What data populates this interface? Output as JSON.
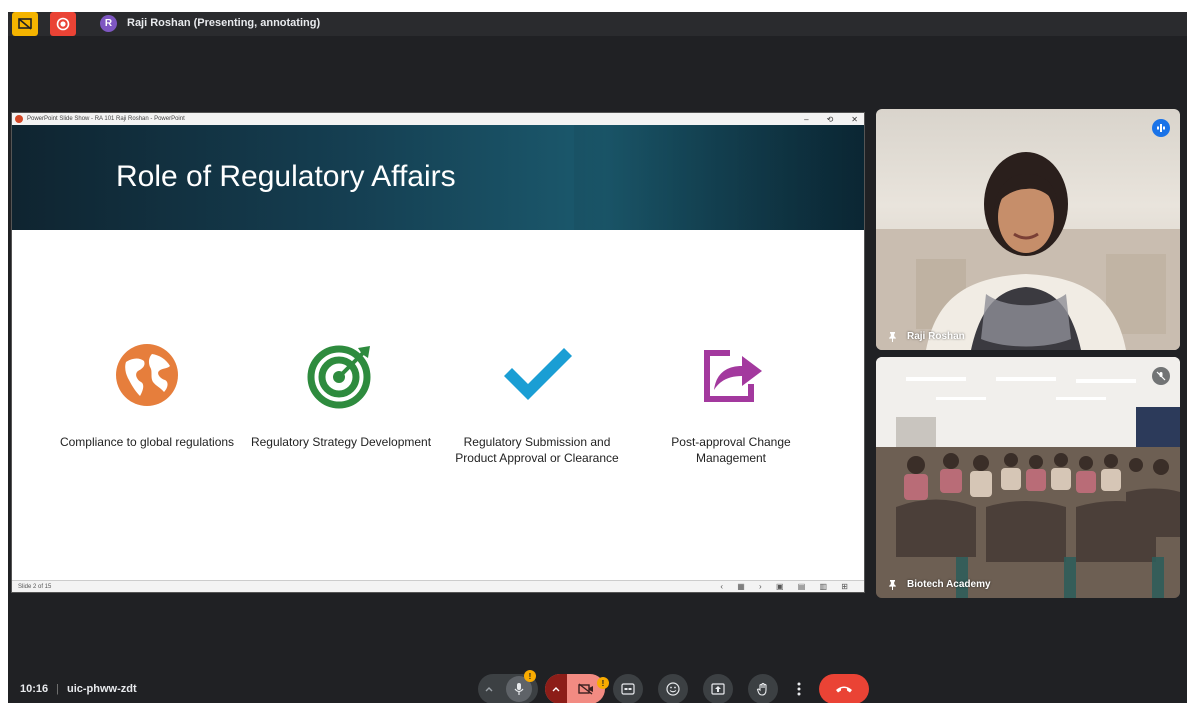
{
  "topbar": {
    "avatar_initial": "R",
    "presenter_text": "Raji Roshan (Presenting, annotating)"
  },
  "powerpoint": {
    "window_title": "PowerPoint Slide Show  -  RA 101 Raji Roshan - PowerPoint",
    "controls": [
      "–",
      "⟲",
      "✕"
    ],
    "status_left": "Slide 2 of 15",
    "status_right": "‹ ▦ › ▣ ▤ ▥ ⊞"
  },
  "slide": {
    "title": "Role of Regulatory Affairs",
    "features": [
      {
        "icon": "globe-icon",
        "color": "#e67e3c",
        "label": "Compliance to global regulations"
      },
      {
        "icon": "target-icon",
        "color": "#2e8b3e",
        "label": "Regulatory Strategy Development"
      },
      {
        "icon": "checkmark-icon",
        "color": "#1a9ed4",
        "label": "Regulatory Submission and Product Approval or Clearance"
      },
      {
        "icon": "share-arrow-icon",
        "color": "#a3399e",
        "label": "Post-approval Change Management"
      }
    ]
  },
  "participants": [
    {
      "name": "Raji Roshan",
      "speaking": true
    },
    {
      "name": "Biotech Academy",
      "speaking": false
    }
  ],
  "meeting": {
    "time": "10:16",
    "separator": "|",
    "code": "uic-phww-zdt"
  },
  "controls": {
    "mic_badge": "!",
    "camera_badge": "!"
  },
  "colors": {
    "meet_background": "#202124",
    "end_call": "#ea4335",
    "accent_blue": "#1a73e8"
  }
}
